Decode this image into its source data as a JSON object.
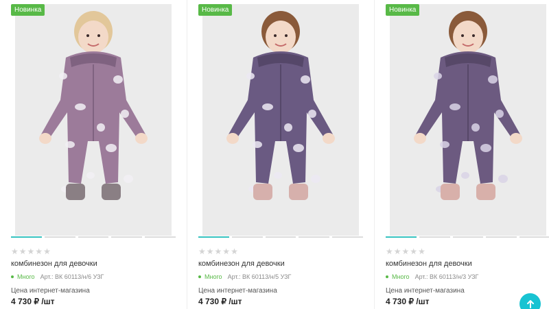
{
  "products": [
    {
      "badge": "Новинка",
      "rating": 0,
      "title": "комбинезон для девочки",
      "stock": "Много",
      "article": "Арт.: ВК 60113/н/6 УЗГ",
      "price_label": "Цена интернет-магазина",
      "price": "4 730 ₽ /шт",
      "colors": {
        "suit": "#9c7b9a",
        "suit_dark": "#7f6280",
        "print": "#f2f0f5",
        "boots": "#8a7f84",
        "hair": "#e2c79a",
        "background": "#ebebeb"
      }
    },
    {
      "badge": "Новинка",
      "rating": 0,
      "title": "комбинезон для девочки",
      "stock": "Много",
      "article": "Арт.: ВК 60113/н/5 УЗГ",
      "price_label": "Цена интернет-магазина",
      "price": "4 730 ₽ /шт",
      "colors": {
        "suit": "#6a5a82",
        "suit_dark": "#554769",
        "print": "#ece9f3",
        "boots": "#d6b0ac",
        "hair": "#8a5a3a",
        "background": "#ebebeb"
      }
    },
    {
      "badge": "Новинка",
      "rating": 0,
      "title": "комбинезон для девочки",
      "stock": "Много",
      "article": "Арт.: ВК 60113/н/3 УЗГ",
      "price_label": "Цена интернет-магазина",
      "price": "4 730 ₽ /шт",
      "colors": {
        "suit": "#6c5a80",
        "suit_dark": "#574868",
        "print": "#d9d3e6",
        "boots": "#d8b0aa",
        "hair": "#8a5a3a",
        "background": "#ebebeb"
      }
    }
  ],
  "ui": {
    "scroll_top_icon": "arrow-up-icon",
    "accent": "#18c3d2",
    "badge_color": "#58b947"
  }
}
